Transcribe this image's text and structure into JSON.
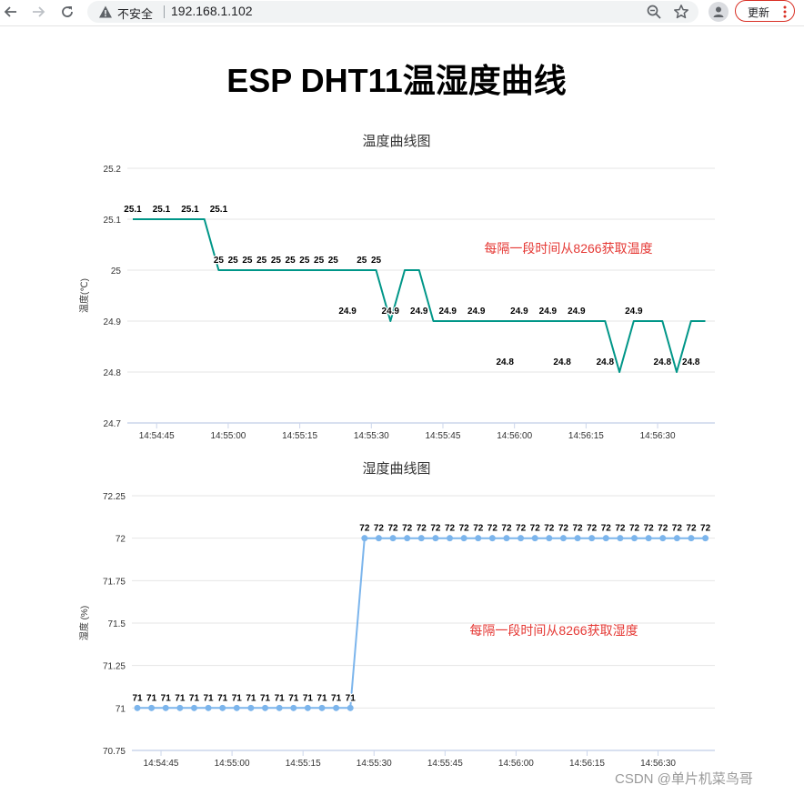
{
  "browser": {
    "security_label": "不安全",
    "url": "192.168.1.102",
    "update_label": "更新",
    "icons": [
      "back-arrow-icon",
      "forward-arrow-icon",
      "reload-icon",
      "warning-icon",
      "zoom-icon",
      "star-icon",
      "profile-icon",
      "more-vert-icon"
    ],
    "colors": {
      "update_border": "#d93025"
    }
  },
  "page": {
    "title": "ESP DHT11温湿度曲线",
    "watermark": "CSDN @单片机菜鸟哥"
  },
  "chart_data": [
    {
      "type": "line",
      "title": "温度曲线图",
      "ylabel": "温度(℃)",
      "xlabel": "",
      "ylim": [
        24.7,
        25.2
      ],
      "yticks": [
        "24.7",
        "24.8",
        "24.9",
        "25",
        "25.1",
        "25.2"
      ],
      "xtick_labels": [
        "14:54:45",
        "14:55:00",
        "14:55:15",
        "14:55:30",
        "14:55:45",
        "14:56:00",
        "14:56:15",
        "14:56:30"
      ],
      "xtick_positions": [
        5,
        20,
        35,
        50,
        65,
        80,
        95,
        110
      ],
      "xlim": [
        0,
        122
      ],
      "grid": true,
      "markers": false,
      "color": "#009688",
      "annotation": "每隔一段时间从8266获取温度",
      "annotation_color": "#e53935",
      "series": [
        {
          "x": [
            0,
            3,
            6,
            9,
            12,
            15,
            18,
            21,
            24,
            27,
            30,
            33,
            36,
            39,
            42,
            45,
            48,
            51,
            54,
            57,
            60,
            63,
            66,
            69,
            72,
            75,
            78,
            81,
            84,
            87,
            90,
            93,
            96,
            99,
            102,
            105,
            108,
            111,
            114,
            117,
            120
          ],
          "values": [
            25.1,
            25.1,
            25.1,
            25.1,
            25.1,
            25.1,
            25,
            25,
            25,
            25,
            25,
            25,
            25,
            25,
            25,
            25,
            25,
            25,
            24.9,
            25,
            25,
            24.9,
            24.9,
            24.9,
            24.9,
            24.9,
            24.9,
            24.9,
            24.9,
            24.9,
            24.9,
            24.9,
            24.9,
            24.9,
            24.8,
            24.9,
            24.9,
            24.9,
            24.8,
            24.9,
            24.9
          ]
        }
      ],
      "data_labels": [
        {
          "x": 0,
          "text": "25.1"
        },
        {
          "x": 6,
          "text": "25.1"
        },
        {
          "x": 12,
          "text": "25.1"
        },
        {
          "x": 18,
          "text": "25.1"
        },
        {
          "x": 18,
          "text": "25"
        },
        {
          "x": 21,
          "text": "25"
        },
        {
          "x": 24,
          "text": "25"
        },
        {
          "x": 27,
          "text": "25"
        },
        {
          "x": 30,
          "text": "25"
        },
        {
          "x": 33,
          "text": "25"
        },
        {
          "x": 36,
          "text": "25"
        },
        {
          "x": 39,
          "text": "25"
        },
        {
          "x": 42,
          "text": "25"
        },
        {
          "x": 45,
          "text": "24.9"
        },
        {
          "x": 48,
          "text": "25"
        },
        {
          "x": 51,
          "text": "25"
        },
        {
          "x": 54,
          "text": "24.9"
        },
        {
          "x": 60,
          "text": "24.9"
        },
        {
          "x": 66,
          "text": "24.9"
        },
        {
          "x": 72,
          "text": "24.9"
        },
        {
          "x": 78,
          "text": "24.8"
        },
        {
          "x": 81,
          "text": "24.9"
        },
        {
          "x": 87,
          "text": "24.9"
        },
        {
          "x": 90,
          "text": "24.8"
        },
        {
          "x": 93,
          "text": "24.9"
        },
        {
          "x": 99,
          "text": "24.8"
        },
        {
          "x": 105,
          "text": "24.9"
        },
        {
          "x": 111,
          "text": "24.8"
        },
        {
          "x": 117,
          "text": "24.8"
        }
      ]
    },
    {
      "type": "line",
      "title": "湿度曲线图",
      "ylabel": "湿度 (%)",
      "xlabel": "",
      "ylim": [
        70.75,
        72.25
      ],
      "yticks": [
        "70.75",
        "71",
        "71.25",
        "71.5",
        "71.75",
        "72",
        "72.25"
      ],
      "xtick_labels": [
        "14:54:45",
        "14:55:00",
        "14:55:15",
        "14:55:30",
        "14:55:45",
        "14:56:00",
        "14:56:15",
        "14:56:30"
      ],
      "xtick_positions": [
        5,
        20,
        35,
        50,
        65,
        80,
        95,
        110
      ],
      "xlim": [
        0,
        122
      ],
      "grid": true,
      "markers": true,
      "color": "#7cb5ec",
      "annotation": "每隔一段时间从8266获取湿度",
      "annotation_color": "#e53935",
      "series": [
        {
          "x": [
            0,
            3,
            6,
            9,
            12,
            15,
            18,
            21,
            24,
            27,
            30,
            33,
            36,
            39,
            42,
            45,
            48,
            51,
            54,
            57,
            60,
            63,
            66,
            69,
            72,
            75,
            78,
            81,
            84,
            87,
            90,
            93,
            96,
            99,
            102,
            105,
            108,
            111,
            114,
            117,
            120
          ],
          "values": [
            71,
            71,
            71,
            71,
            71,
            71,
            71,
            71,
            71,
            71,
            71,
            71,
            71,
            71,
            71,
            71,
            72,
            72,
            72,
            72,
            72,
            72,
            72,
            72,
            72,
            72,
            72,
            72,
            72,
            72,
            72,
            72,
            72,
            72,
            72,
            72,
            72,
            72,
            72,
            72,
            72
          ]
        }
      ],
      "data_labels": [
        {
          "x": 0,
          "text": "71"
        },
        {
          "x": 3,
          "text": "71"
        },
        {
          "x": 6,
          "text": "71"
        },
        {
          "x": 9,
          "text": "71"
        },
        {
          "x": 12,
          "text": "71"
        },
        {
          "x": 15,
          "text": "71"
        },
        {
          "x": 18,
          "text": "71"
        },
        {
          "x": 21,
          "text": "71"
        },
        {
          "x": 24,
          "text": "71"
        },
        {
          "x": 27,
          "text": "71"
        },
        {
          "x": 30,
          "text": "71"
        },
        {
          "x": 33,
          "text": "71"
        },
        {
          "x": 36,
          "text": "71"
        },
        {
          "x": 39,
          "text": "71"
        },
        {
          "x": 42,
          "text": "71"
        },
        {
          "x": 45,
          "text": "71"
        },
        {
          "x": 48,
          "text": "72"
        },
        {
          "x": 51,
          "text": "72"
        },
        {
          "x": 54,
          "text": "72"
        },
        {
          "x": 57,
          "text": "72"
        },
        {
          "x": 60,
          "text": "72"
        },
        {
          "x": 63,
          "text": "72"
        },
        {
          "x": 66,
          "text": "72"
        },
        {
          "x": 69,
          "text": "72"
        },
        {
          "x": 72,
          "text": "72"
        },
        {
          "x": 75,
          "text": "72"
        },
        {
          "x": 78,
          "text": "72"
        },
        {
          "x": 81,
          "text": "72"
        },
        {
          "x": 84,
          "text": "72"
        },
        {
          "x": 87,
          "text": "72"
        },
        {
          "x": 90,
          "text": "72"
        },
        {
          "x": 93,
          "text": "72"
        },
        {
          "x": 96,
          "text": "72"
        },
        {
          "x": 99,
          "text": "72"
        },
        {
          "x": 102,
          "text": "72"
        },
        {
          "x": 105,
          "text": "72"
        },
        {
          "x": 108,
          "text": "72"
        },
        {
          "x": 111,
          "text": "72"
        },
        {
          "x": 114,
          "text": "72"
        },
        {
          "x": 117,
          "text": "72"
        },
        {
          "x": 120,
          "text": "72"
        }
      ]
    }
  ]
}
